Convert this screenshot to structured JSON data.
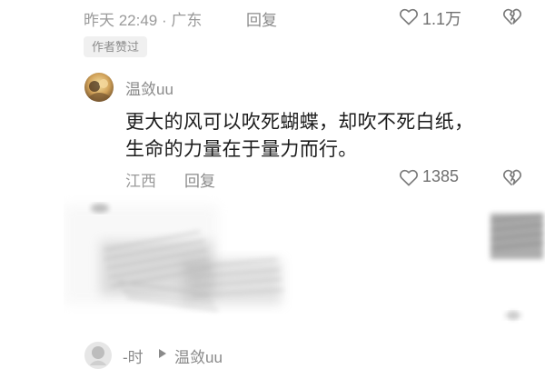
{
  "previous_comment": {
    "time_location": "昨天 22:49 · 广东",
    "reply_label": "回复",
    "like_count": "1.1万",
    "badge": "作者赞过"
  },
  "reply_comment": {
    "username": "温敛uu",
    "lines": [
      "更大的风可以吹死蝴蝶，却吹不死白纸，",
      "生命的力量在于量力而行。"
    ],
    "location": "江西",
    "reply_label": "回复",
    "like_count": "1385"
  },
  "next_reply": {
    "username": "-时",
    "reply_to": "温敛uu"
  },
  "icons": {
    "like": "heart-outline-icon",
    "dislike": "broken-heart-icon",
    "arrow": "play-arrow-icon"
  },
  "colors": {
    "muted_text": "#8a8a8a",
    "body_text": "#1c1c1c",
    "badge_bg": "#f0f0f0"
  }
}
